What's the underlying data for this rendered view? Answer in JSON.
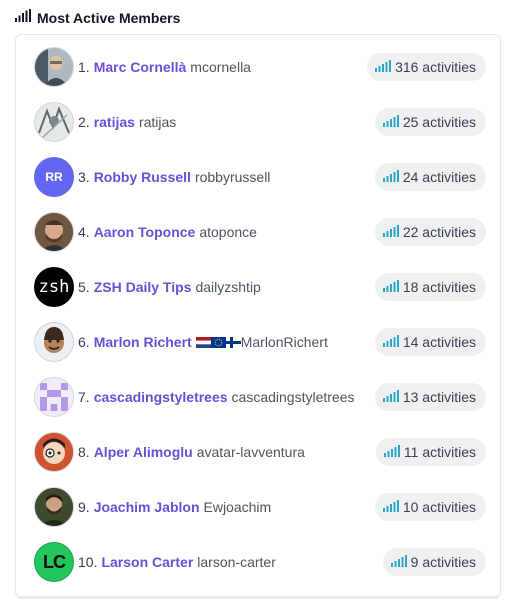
{
  "header": {
    "title": "Most Active Members",
    "icon": "signal-bars-icon"
  },
  "colors": {
    "accent_name": "#6a4fd8",
    "signal_bar": "#2aa6c9",
    "badge_bg": "#f0f0f3"
  },
  "members": [
    {
      "rank": "1.",
      "name": "Marc Cornellà",
      "handle": "mcornella",
      "activities": "316 activities",
      "avatar": "photo-man-glasses"
    },
    {
      "rank": "2.",
      "name": "ratijas",
      "handle": "ratijas",
      "activities": "25 activities",
      "avatar": "photo-sketch"
    },
    {
      "rank": "3.",
      "name": "Robby Russell",
      "handle": "robbyrussell",
      "activities": "24 activities",
      "avatar": "initials",
      "initials": "RR"
    },
    {
      "rank": "4.",
      "name": "Aaron Toponce",
      "handle": "atoponce",
      "activities": "22 activities",
      "avatar": "photo-man-beard"
    },
    {
      "rank": "5.",
      "name": "ZSH Daily Tips",
      "handle": "dailyzshtip",
      "activities": "18 activities",
      "avatar": "zsh-logo",
      "logo_text": "zsh"
    },
    {
      "rank": "6.",
      "name": "Marlon Richert",
      "handle": "MarlonRichert",
      "activities": "14 activities",
      "avatar": "cartoon-face",
      "flags": [
        "netherlands-flag-icon",
        "eu-flag-icon",
        "finland-flag-icon"
      ]
    },
    {
      "rank": "7.",
      "name": "cascadingstyletrees",
      "handle": "cascadingstyletrees",
      "activities": "13 activities",
      "avatar": "identicon-purple"
    },
    {
      "rank": "8.",
      "name": "Alper Alimoglu",
      "handle": "avatar-lavventura",
      "activities": "11 activities",
      "avatar": "photo-clockwork"
    },
    {
      "rank": "9.",
      "name": "Joachim Jablon",
      "handle": "Ewjoachim",
      "activities": "10 activities",
      "avatar": "photo-man-dark"
    },
    {
      "rank": "10.",
      "name": "Larson Carter",
      "handle": "larson-carter",
      "activities": "9 activities",
      "avatar": "lc-logo",
      "logo_text": "LC"
    }
  ]
}
